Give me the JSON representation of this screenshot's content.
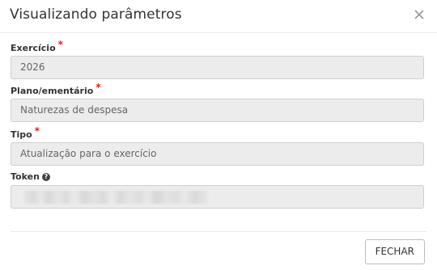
{
  "modal": {
    "title": "Visualizando parâmetros",
    "close_icon": "close-icon"
  },
  "fields": {
    "exercicio": {
      "label": "Exercício",
      "required_mark": "*",
      "value": "2026"
    },
    "plano": {
      "label": "Plano/ementário",
      "required_mark": "*",
      "value": "Naturezas de despesa"
    },
    "tipo": {
      "label": "Tipo",
      "required_mark": "*",
      "value": "Atualização para o exercício"
    },
    "token": {
      "label": "Token",
      "help_icon": "question-circle-icon",
      "help_glyph": "?"
    }
  },
  "footer": {
    "close_label": "FECHAR"
  },
  "colors": {
    "required": "#e01b1b",
    "input_bg": "#ececec",
    "input_border": "#cfcfcf"
  }
}
